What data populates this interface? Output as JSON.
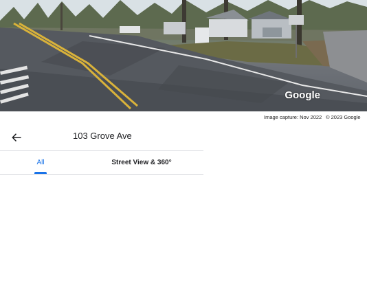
{
  "streetview": {
    "watermark": "Google",
    "capture_date": "Image capture: Nov 2022",
    "copyright": "© 2023 Google"
  },
  "header": {
    "back_icon": "arrow-left-icon",
    "title": "103 Grove Ave"
  },
  "tabs": [
    {
      "label": "All",
      "selected": true
    },
    {
      "label": "Street View & 360°",
      "selected": false
    }
  ],
  "colors": {
    "accent": "#1a73e8",
    "divider": "#dadce0",
    "text": "#202124"
  }
}
